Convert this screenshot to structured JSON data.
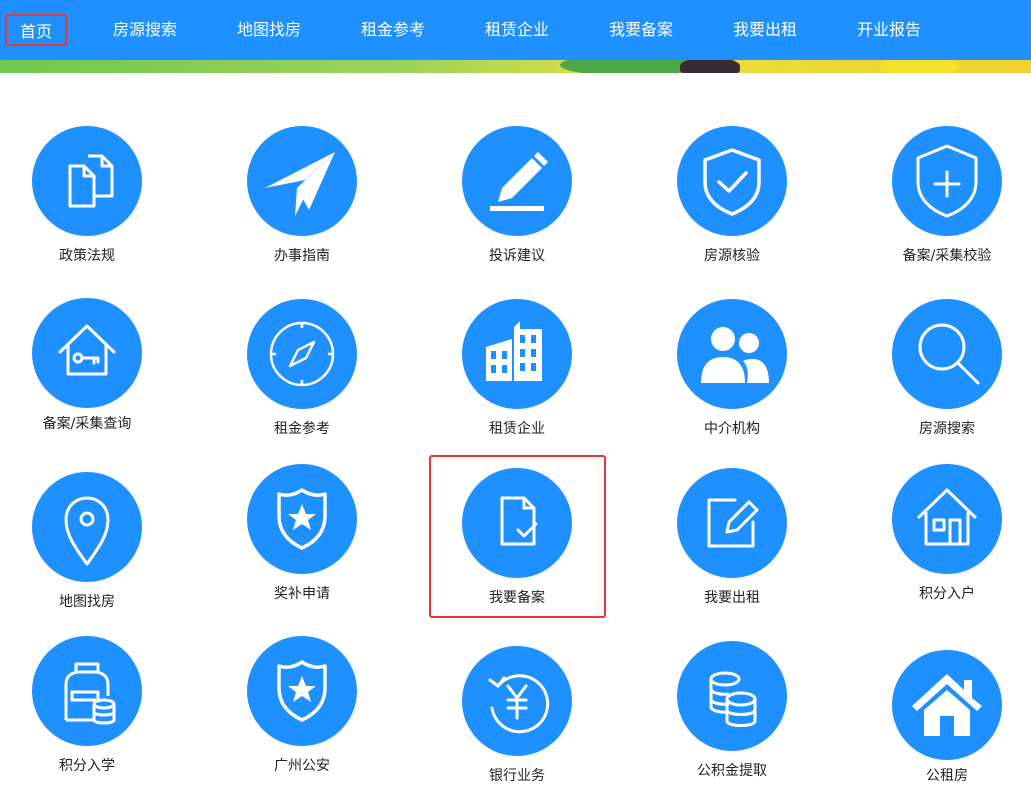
{
  "nav": {
    "items": [
      "首页",
      "房源搜索",
      "地图找房",
      "租金参考",
      "租赁企业",
      "我要备案",
      "我要出租",
      "开业报告"
    ],
    "active_index": 0
  },
  "tiles": [
    {
      "label": "政策法规",
      "icon": "documents-icon"
    },
    {
      "label": "办事指南",
      "icon": "paper-plane-icon"
    },
    {
      "label": "投诉建议",
      "icon": "pencil-icon"
    },
    {
      "label": "房源核验",
      "icon": "shield-check-icon"
    },
    {
      "label": "备案/采集校验",
      "icon": "shield-plus-icon"
    },
    {
      "label": "备案/采集查询",
      "icon": "house-key-icon"
    },
    {
      "label": "租金参考",
      "icon": "compass-icon"
    },
    {
      "label": "租赁企业",
      "icon": "buildings-icon"
    },
    {
      "label": "中介机构",
      "icon": "users-icon"
    },
    {
      "label": "房源搜索",
      "icon": "search-icon"
    },
    {
      "label": "地图找房",
      "icon": "map-pin-icon"
    },
    {
      "label": "奖补申请",
      "icon": "badge-star-icon"
    },
    {
      "label": "我要备案",
      "icon": "file-check-icon"
    },
    {
      "label": "我要出租",
      "icon": "edit-icon"
    },
    {
      "label": "积分入户",
      "icon": "home-outline-icon"
    },
    {
      "label": "积分入学",
      "icon": "backpack-icon"
    },
    {
      "label": "广州公安",
      "icon": "police-badge-icon"
    },
    {
      "label": "银行业务",
      "icon": "yuan-cycle-icon"
    },
    {
      "label": "公积金提取",
      "icon": "coins-icon"
    },
    {
      "label": "公租房",
      "icon": "home-solid-icon"
    }
  ],
  "colors": {
    "primary": "#1e90ff",
    "highlight": "#e53935"
  }
}
